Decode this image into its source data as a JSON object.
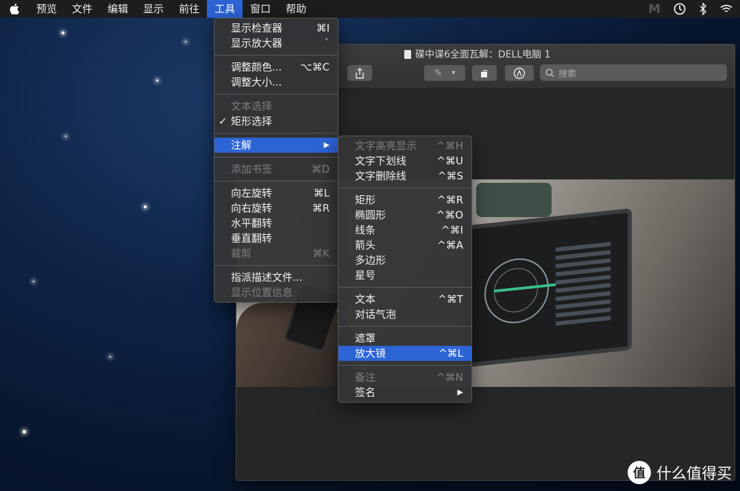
{
  "menubar": {
    "items": [
      "预览",
      "文件",
      "编辑",
      "显示",
      "前往",
      "工具",
      "窗口",
      "帮助"
    ],
    "active_index": 5
  },
  "window": {
    "title": "碟中谍6全面瓦解：DELL电脑 1",
    "search_placeholder": "搜索"
  },
  "tools_menu": {
    "groups": [
      [
        {
          "label": "显示检查器",
          "shortcut": "⌘I"
        },
        {
          "label": "显示放大器",
          "shortcut": "`"
        }
      ],
      [
        {
          "label": "调整颜色...",
          "shortcut": "⌥⌘C"
        },
        {
          "label": "调整大小..."
        }
      ],
      [
        {
          "label": "文本选择",
          "disabled": true
        },
        {
          "label": "矩形选择",
          "checked": true
        }
      ],
      [
        {
          "label": "注解",
          "submenu": true,
          "highlighted": true
        }
      ],
      [
        {
          "label": "添加书签",
          "shortcut": "⌘D",
          "disabled": true
        }
      ],
      [
        {
          "label": "向左旋转",
          "shortcut": "⌘L"
        },
        {
          "label": "向右旋转",
          "shortcut": "⌘R"
        },
        {
          "label": "水平翻转"
        },
        {
          "label": "垂直翻转"
        },
        {
          "label": "裁剪",
          "shortcut": "⌘K",
          "disabled": true
        }
      ],
      [
        {
          "label": "指派描述文件..."
        },
        {
          "label": "显示位置信息",
          "disabled": true
        }
      ]
    ]
  },
  "annotate_menu": {
    "groups": [
      [
        {
          "label": "文字高亮显示",
          "shortcut": "^⌘H",
          "disabled": true
        },
        {
          "label": "文字下划线",
          "shortcut": "^⌘U"
        },
        {
          "label": "文字删除线",
          "shortcut": "^⌘S"
        }
      ],
      [
        {
          "label": "矩形",
          "shortcut": "^⌘R"
        },
        {
          "label": "椭圆形",
          "shortcut": "^⌘O"
        },
        {
          "label": "线条",
          "shortcut": "^⌘I"
        },
        {
          "label": "箭头",
          "shortcut": "^⌘A"
        },
        {
          "label": "多边形"
        },
        {
          "label": "星号"
        }
      ],
      [
        {
          "label": "文本",
          "shortcut": "^⌘T"
        },
        {
          "label": "对话气泡"
        }
      ],
      [
        {
          "label": "遮罩"
        },
        {
          "label": "放大镜",
          "shortcut": "^⌘L",
          "highlighted": true
        }
      ],
      [
        {
          "label": "备注",
          "shortcut": "^⌘N",
          "disabled": true
        },
        {
          "label": "签名",
          "submenu": true
        }
      ]
    ]
  },
  "watermark": {
    "icon_text": "值",
    "text": "什么值得买"
  },
  "colors": {
    "highlight": "#2c64d6",
    "menubar": "#1d1d1f"
  }
}
